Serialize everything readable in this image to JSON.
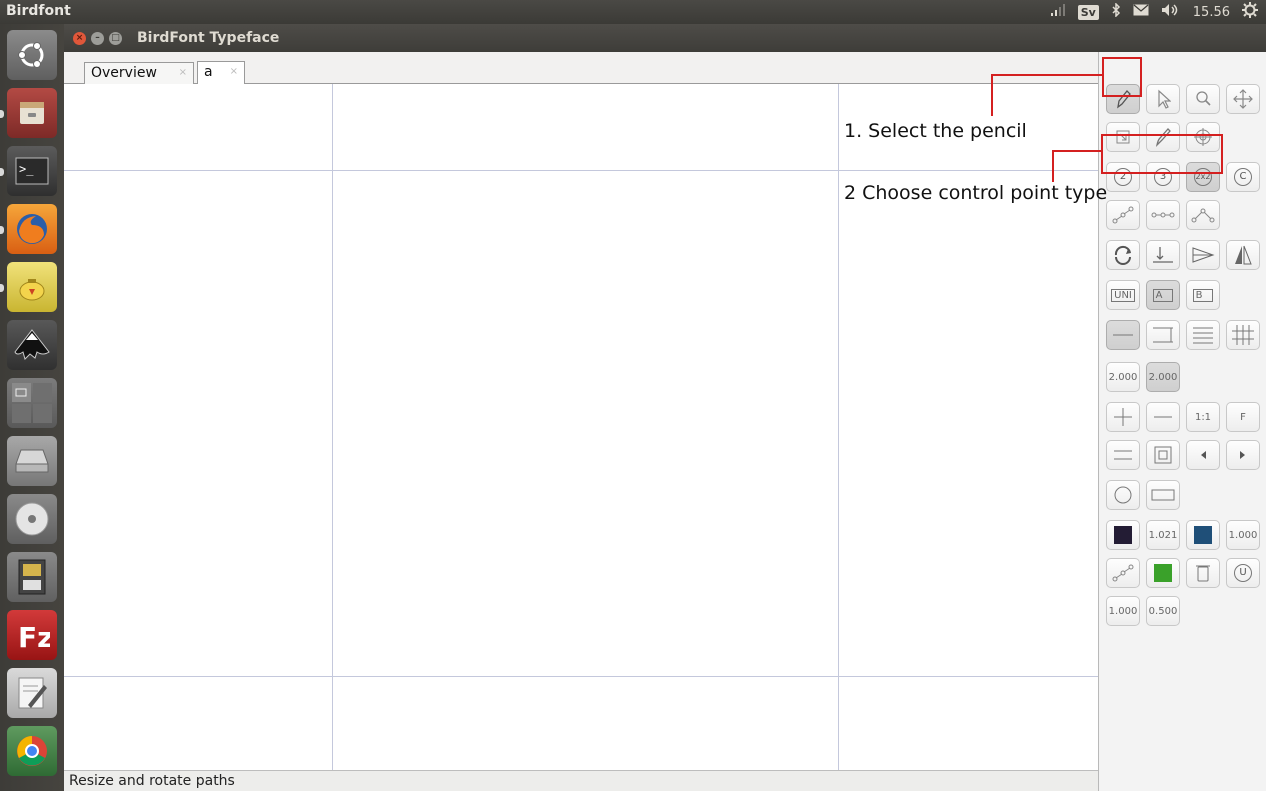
{
  "top_panel": {
    "app_name": "Birdfont",
    "keyboard_layout": "Sv",
    "clock": "15.56",
    "icons": [
      "signal-icon",
      "bluetooth-icon",
      "mail-icon",
      "volume-icon",
      "settings-gear-icon"
    ]
  },
  "launcher": {
    "items": [
      {
        "name": "ubuntu-dash",
        "color": "#7a7a7a"
      },
      {
        "name": "file-manager",
        "color": "#9a3a37"
      },
      {
        "name": "terminal",
        "color": "#2b2b2b"
      },
      {
        "name": "firefox",
        "color": "#e66000"
      },
      {
        "name": "teapot-app",
        "color": "#d6c23a"
      },
      {
        "name": "inkscape",
        "color": "#2a2a2a"
      },
      {
        "name": "workspace-switcher",
        "color": "#6e6e6e"
      },
      {
        "name": "disk-drive",
        "color": "#9d9d9d"
      },
      {
        "name": "cd-drive",
        "color": "#c9c9c9"
      },
      {
        "name": "sd-card",
        "color": "#8c6d9e"
      },
      {
        "name": "filezilla",
        "color": "#bf1c1c"
      },
      {
        "name": "text-editor",
        "color": "#d0d0d0"
      },
      {
        "name": "chrome",
        "color": "#3b8d3e"
      }
    ]
  },
  "window": {
    "title": "BirdFont Typeface"
  },
  "tabs": [
    {
      "label": "Overview",
      "close": "×"
    },
    {
      "label": "a",
      "close": "×"
    }
  ],
  "status": {
    "text": "Resize and rotate paths"
  },
  "toolbox": {
    "stroke_width_1": "2.000",
    "stroke_width_2": "2.000",
    "zoom_1to1": "1:1",
    "fullscreen": "F",
    "unicode_label": "UNI",
    "a_label": "A",
    "b_label": "B",
    "c_label": "C",
    "point_2": "2",
    "point_3": "3",
    "point_2x2": "2x2",
    "u_label": "U",
    "fill_value_1": "1.021",
    "fill_value_2": "1.000",
    "opacity_1": "1.000",
    "opacity_2": "0.500",
    "colors": {
      "fill_dark": "#231c34",
      "fill_blue": "#1f4f78",
      "fill_green": "#3aa12a"
    }
  },
  "annotations": {
    "step1": "1. Select the pencil",
    "step2": "2 Choose control point type",
    "color": "#d42020"
  }
}
